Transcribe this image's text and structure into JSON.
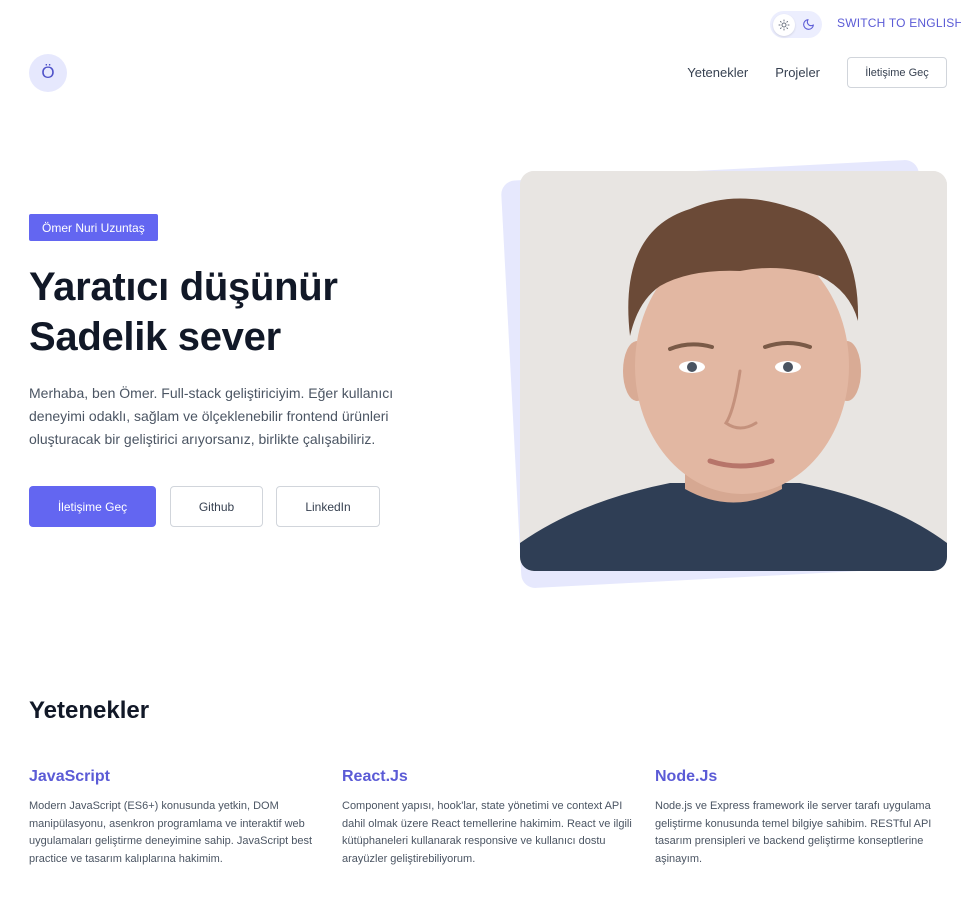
{
  "topbar": {
    "theme_light_icon": "sun-icon",
    "theme_dark_icon": "moon-icon",
    "language_switch": "SWITCH TO ENGLISH"
  },
  "header": {
    "logo_letter": "Ö",
    "nav": [
      {
        "label": "Yetenekler"
      },
      {
        "label": "Projeler"
      }
    ],
    "cta_label": "İletişime Geç"
  },
  "hero": {
    "badge": "Ömer Nuri Uzuntaş",
    "title_line1": "Yaratıcı düşünür",
    "title_line2": "Sadelik sever",
    "description": "Merhaba, ben Ömer. Full-stack geliştiriciyim. Eğer kullanıcı deneyimi odaklı, sağlam ve ölçeklenebilir frontend ürünleri oluşturacak bir geliştirici arıyorsanız, birlikte çalışabiliriz.",
    "buttons": {
      "contact": "İletişime Geç",
      "github": "Github",
      "linkedin": "LinkedIn"
    }
  },
  "skills": {
    "title": "Yetenekler",
    "items": [
      {
        "name": "JavaScript",
        "description": "Modern JavaScript (ES6+) konusunda yetkin, DOM manipülasyonu, asenkron programlama ve interaktif web uygulamaları geliştirme deneyimine sahip. JavaScript best practice ve tasarım kalıplarına hakimim."
      },
      {
        "name": "React.Js",
        "description": "Component yapısı, hook'lar, state yönetimi ve context API dahil olmak üzere React temellerine hakimim. React ve ilgili kütüphaneleri kullanarak responsive ve kullanıcı dostu arayüzler geliştirebiliyorum."
      },
      {
        "name": "Node.Js",
        "description": "Node.js ve Express framework ile server tarafı uygulama geliştirme konusunda temel bilgiye sahibim. RESTful API tasarım prensipleri ve backend geliştirme konseptlerine aşinayım."
      }
    ]
  },
  "colors": {
    "accent": "#6366f1",
    "accent_light": "#e6e8fd",
    "heading": "#111827",
    "body_text": "#4b5563"
  }
}
